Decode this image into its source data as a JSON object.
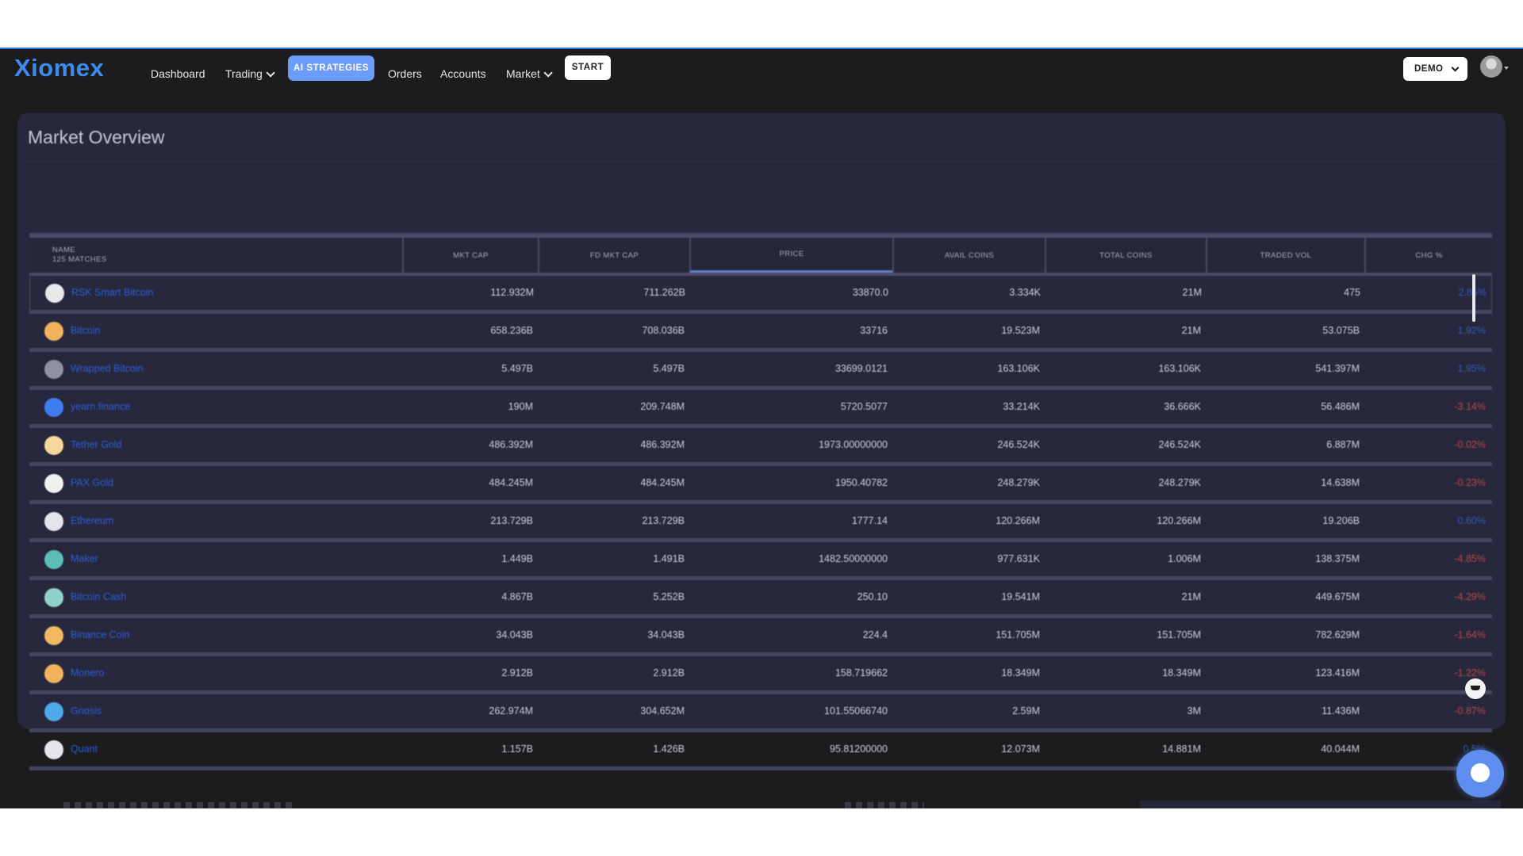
{
  "brand": {
    "name": "Xiomex",
    "color": "#3d8bef"
  },
  "nav": {
    "items": [
      {
        "label": "Dashboard",
        "dropdown": false
      },
      {
        "label": "Trading",
        "dropdown": true
      },
      {
        "label": "Orders",
        "dropdown": false
      },
      {
        "label": "Accounts",
        "dropdown": false
      },
      {
        "label": "Market",
        "dropdown": true
      }
    ],
    "ai_strategies_label": "AI STRATEGIES",
    "start_label": "START",
    "account_mode": "DEMO"
  },
  "market": {
    "title": "Market Overview",
    "columns": {
      "name": "NAME",
      "matches": "125 MATCHES",
      "mkt_cap": "MKT CAP",
      "fd_mkt_cap": "FD MKT CAP",
      "price": "PRICE",
      "avail_coins": "AVAIL COINS",
      "total_coins": "TOTAL COINS",
      "traded_vol": "TRADED VOL",
      "chg": "CHG %"
    },
    "sorted_column": "PRICE",
    "colors": {
      "positive": "#3556b8",
      "negative": "#b94848",
      "link": "#2e5bd6"
    },
    "rows": [
      {
        "icon": "bitcoin-icon",
        "icon_color": "#e8e8ea",
        "name": "RSK Smart Bitcoin",
        "mkt_cap": "112.932M",
        "fd_mkt_cap": "711.262B",
        "price": "33870.0",
        "avail_coins": "3.334K",
        "total_coins": "21M",
        "traded_vol": "475",
        "chg": "2.85%",
        "direction": "up"
      },
      {
        "icon": "bitcoin-icon",
        "icon_color": "#f0b35c",
        "name": "Bitcoin",
        "mkt_cap": "658.236B",
        "fd_mkt_cap": "708.036B",
        "price": "33716",
        "avail_coins": "19.523M",
        "total_coins": "21M",
        "traded_vol": "53.075B",
        "chg": "1.92%",
        "direction": "up"
      },
      {
        "icon": "wrapped-bitcoin-icon",
        "icon_color": "#8f90a0",
        "name": "Wrapped Bitcoin",
        "mkt_cap": "5.497B",
        "fd_mkt_cap": "5.497B",
        "price": "33699.0121",
        "avail_coins": "163.106K",
        "total_coins": "163.106K",
        "traded_vol": "541.397M",
        "chg": "1.95%",
        "direction": "up"
      },
      {
        "icon": "yearn-finance-icon",
        "icon_color": "#3d7df0",
        "name": "yearn.finance",
        "mkt_cap": "190M",
        "fd_mkt_cap": "209.748M",
        "price": "5720.5077",
        "avail_coins": "33.214K",
        "total_coins": "36.666K",
        "traded_vol": "56.486M",
        "chg": "-3.14%",
        "direction": "down"
      },
      {
        "icon": "tether-gold-icon",
        "icon_color": "#f3d79b",
        "name": "Tether Gold",
        "mkt_cap": "486.392M",
        "fd_mkt_cap": "486.392M",
        "price": "1973.00000000",
        "avail_coins": "246.524K",
        "total_coins": "246.524K",
        "traded_vol": "6.887M",
        "chg": "-0.02%",
        "direction": "down"
      },
      {
        "icon": "pax-gold-icon",
        "icon_color": "#f0f0f0",
        "name": "PAX Gold",
        "mkt_cap": "484.245M",
        "fd_mkt_cap": "484.245M",
        "price": "1950.40782",
        "avail_coins": "248.279K",
        "total_coins": "248.279K",
        "traded_vol": "14.638M",
        "chg": "-0.23%",
        "direction": "down"
      },
      {
        "icon": "ethereum-icon",
        "icon_color": "#e4e4ea",
        "name": "Ethereum",
        "mkt_cap": "213.729B",
        "fd_mkt_cap": "213.729B",
        "price": "1777.14",
        "avail_coins": "120.266M",
        "total_coins": "120.266M",
        "traded_vol": "19.206B",
        "chg": "0.60%",
        "direction": "up"
      },
      {
        "icon": "maker-icon",
        "icon_color": "#5bbdb4",
        "name": "Maker",
        "mkt_cap": "1.449B",
        "fd_mkt_cap": "1.491B",
        "price": "1482.50000000",
        "avail_coins": "977.631K",
        "total_coins": "1.006M",
        "traded_vol": "138.375M",
        "chg": "-4.85%",
        "direction": "down"
      },
      {
        "icon": "bitcoin-cash-icon",
        "icon_color": "#8fd1c9",
        "name": "Bitcoin Cash",
        "mkt_cap": "4.867B",
        "fd_mkt_cap": "5.252B",
        "price": "250.10",
        "avail_coins": "19.541M",
        "total_coins": "21M",
        "traded_vol": "449.675M",
        "chg": "-4.29%",
        "direction": "down"
      },
      {
        "icon": "binance-coin-icon",
        "icon_color": "#f0b860",
        "name": "Binance Coin",
        "mkt_cap": "34.043B",
        "fd_mkt_cap": "34.043B",
        "price": "224.4",
        "avail_coins": "151.705M",
        "total_coins": "151.705M",
        "traded_vol": "782.629M",
        "chg": "-1.64%",
        "direction": "down"
      },
      {
        "icon": "monero-icon",
        "icon_color": "#f0b35c",
        "name": "Monero",
        "mkt_cap": "2.912B",
        "fd_mkt_cap": "2.912B",
        "price": "158.719662",
        "avail_coins": "18.349M",
        "total_coins": "18.349M",
        "traded_vol": "123.416M",
        "chg": "-1.22%",
        "direction": "down"
      },
      {
        "icon": "gnosis-icon",
        "icon_color": "#4ea9e8",
        "name": "Gnosis",
        "mkt_cap": "262.974M",
        "fd_mkt_cap": "304.652M",
        "price": "101.55066740",
        "avail_coins": "2.59M",
        "total_coins": "3M",
        "traded_vol": "11.436M",
        "chg": "-0.87%",
        "direction": "down"
      },
      {
        "icon": "quant-icon",
        "icon_color": "#e6e6ea",
        "name": "Quant",
        "mkt_cap": "1.157B",
        "fd_mkt_cap": "1.426B",
        "price": "95.81200000",
        "avail_coins": "12.073M",
        "total_coins": "14.881M",
        "traded_vol": "40.044M",
        "chg": "0.5%",
        "direction": "up"
      }
    ]
  }
}
